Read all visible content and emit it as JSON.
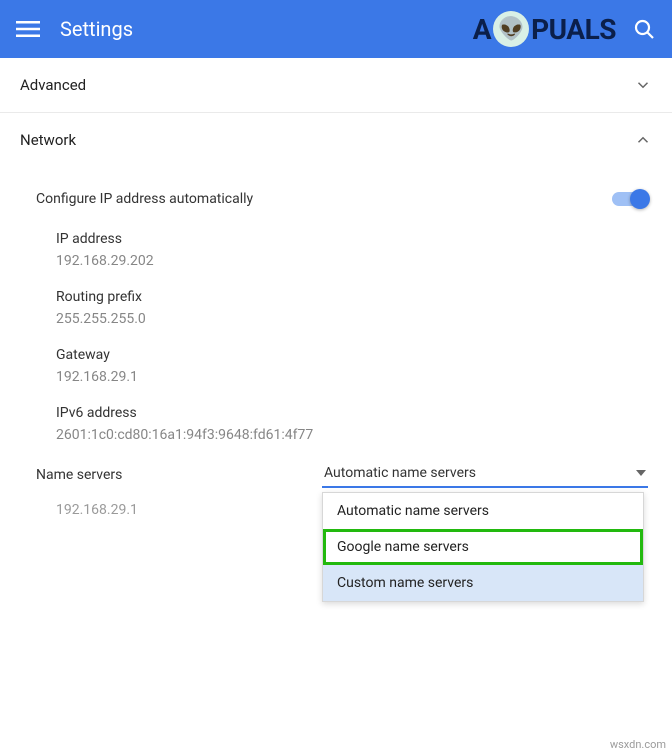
{
  "header": {
    "title": "Settings",
    "brand": {
      "prefix": "A",
      "suffix": "PUALS"
    }
  },
  "sections": {
    "advanced": {
      "label": "Advanced"
    },
    "network": {
      "label": "Network"
    }
  },
  "network": {
    "configure_auto": {
      "label": "Configure IP address automatically",
      "enabled": true
    },
    "ip_address": {
      "label": "IP address",
      "value": "192.168.29.202"
    },
    "routing_prefix": {
      "label": "Routing prefix",
      "value": "255.255.255.0"
    },
    "gateway": {
      "label": "Gateway",
      "value": "192.168.29.1"
    },
    "ipv6": {
      "label": "IPv6 address",
      "value": "2601:1c0:cd80:16a1:94f3:9648:fd61:4f77"
    },
    "name_servers": {
      "label": "Name servers",
      "selected": "Automatic name servers",
      "value": "192.168.29.1",
      "options": {
        "auto": "Automatic name servers",
        "google": "Google name servers",
        "custom": "Custom name servers"
      }
    }
  },
  "watermark": "wsxdn.com"
}
